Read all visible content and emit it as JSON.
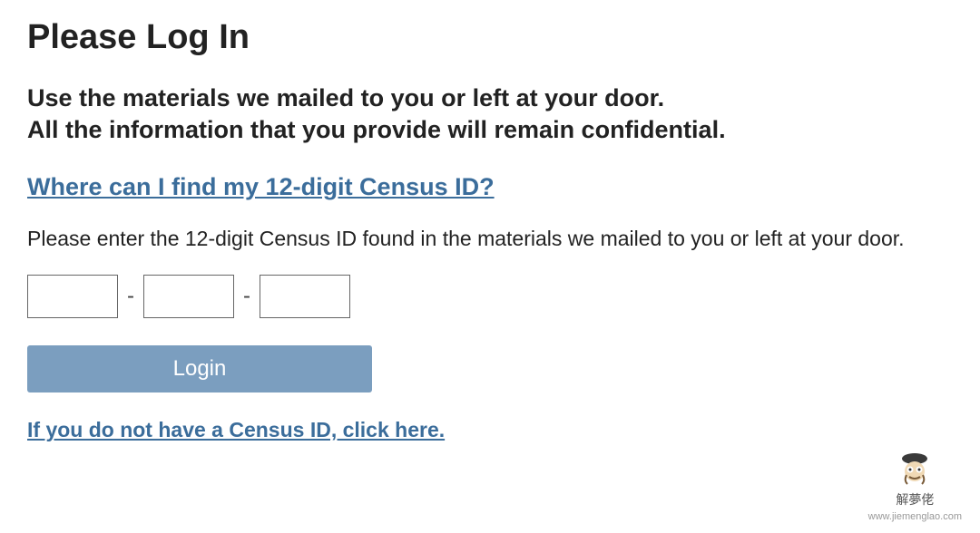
{
  "title": "Please Log In",
  "intro_line1": "Use the materials we mailed to you or left at your door.",
  "intro_line2": "All the information that you provide will remain confidential.",
  "help_link": "Where can I find my 12-digit Census ID?",
  "instruction": "Please enter the 12-digit Census ID found in the materials we mailed to you or left at your door.",
  "separator": "-",
  "login_label": "Login",
  "no_id_link": "If you do not have a Census ID, click here.",
  "watermark": {
    "brand_cn": "解夢佬",
    "url": "www.jiemenglao.com"
  }
}
